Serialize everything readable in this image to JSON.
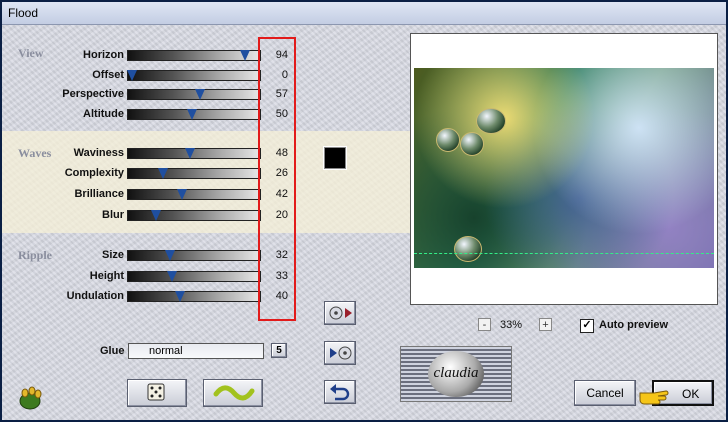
{
  "window": {
    "title": "Flood"
  },
  "groups": [
    {
      "name": "View",
      "params": [
        {
          "label": "Horizon",
          "value": "94",
          "fraction": 0.94
        },
        {
          "label": "Offset",
          "value": "0",
          "fraction": 0.0
        },
        {
          "label": "Perspective",
          "value": "57",
          "fraction": 0.57
        },
        {
          "label": "Altitude",
          "value": "50",
          "fraction": 0.5
        }
      ]
    },
    {
      "name": "Waves",
      "params": [
        {
          "label": "Waviness",
          "value": "48",
          "fraction": 0.48
        },
        {
          "label": "Complexity",
          "value": "26",
          "fraction": 0.26
        },
        {
          "label": "Brilliance",
          "value": "42",
          "fraction": 0.42
        },
        {
          "label": "Blur",
          "value": "20",
          "fraction": 0.2
        }
      ]
    },
    {
      "name": "Ripple",
      "params": [
        {
          "label": "Size",
          "value": "32",
          "fraction": 0.32
        },
        {
          "label": "Height",
          "value": "33",
          "fraction": 0.33
        },
        {
          "label": "Undulation",
          "value": "40",
          "fraction": 0.4
        }
      ]
    }
  ],
  "color_swatch": "#000000",
  "glue": {
    "label": "Glue",
    "value": "normal",
    "shortcut": "5"
  },
  "zoom": {
    "minus": "-",
    "value": "33%",
    "plus": "+"
  },
  "auto_preview": {
    "label": "Auto preview",
    "checked": true
  },
  "logo_text": "claudia",
  "buttons": {
    "cancel": "Cancel",
    "ok": "OK"
  },
  "icons": [
    "plugin-icon",
    "dice-icon",
    "wave-icon",
    "load-preset-icon",
    "save-preset-icon",
    "undo-icon",
    "pointing-hand-icon"
  ]
}
